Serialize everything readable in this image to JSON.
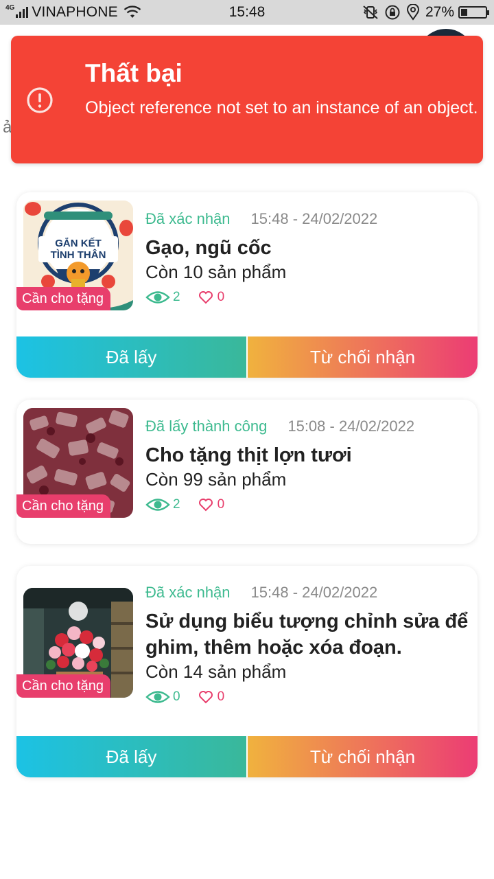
{
  "status_bar": {
    "network": "4G",
    "carrier": "VINAPHONE",
    "time": "15:48",
    "battery": "27%",
    "icons": [
      "signal-icon",
      "wifi-icon",
      "vibrate-icon",
      "rotation-lock-icon",
      "location-icon",
      "battery-icon"
    ]
  },
  "background": {
    "partial_letter": "ả"
  },
  "toast": {
    "icon": "error-circle-icon",
    "title": "Thất bại",
    "message": "Object reference not set to an instance of an object.",
    "color": "#f44336"
  },
  "colors": {
    "status_green": "#3dba8f",
    "tag_pink": "#e83e6c",
    "taken_gradient": [
      "#1cc2e4",
      "#3ab89a"
    ],
    "reject_gradient": [
      "#f0b23e",
      "#ec3c74"
    ]
  },
  "cards": [
    {
      "status": "Đã xác nhận",
      "time": "15:48 - 24/02/2022",
      "title": "Gạo, ngũ cốc",
      "stock": "Còn 10 sản phẩm",
      "views": "2",
      "likes": "0",
      "tag": "Cần cho tặng",
      "thumb_text": [
        "GẮN KẾT",
        "TÌNH THÂN"
      ],
      "actions": {
        "taken": "Đã lấy",
        "reject": "Từ chối nhận"
      }
    },
    {
      "status": "Đã lấy thành công",
      "time": "15:08 - 24/02/2022",
      "title": "Cho tặng thịt lợn tươi",
      "stock": "Còn 99 sản phẩm",
      "views": "2",
      "likes": "0",
      "tag": "Cần cho tặng"
    },
    {
      "status": "Đã xác nhận",
      "time": "15:48 - 24/02/2022",
      "title": "Sử dụng biểu tượng chỉnh sửa để ghim, thêm hoặc xóa đoạn.",
      "stock": "Còn 14 sản phẩm",
      "views": "0",
      "likes": "0",
      "tag": "Cần cho tặng",
      "actions": {
        "taken": "Đã lấy",
        "reject": "Từ chối nhận"
      }
    }
  ]
}
